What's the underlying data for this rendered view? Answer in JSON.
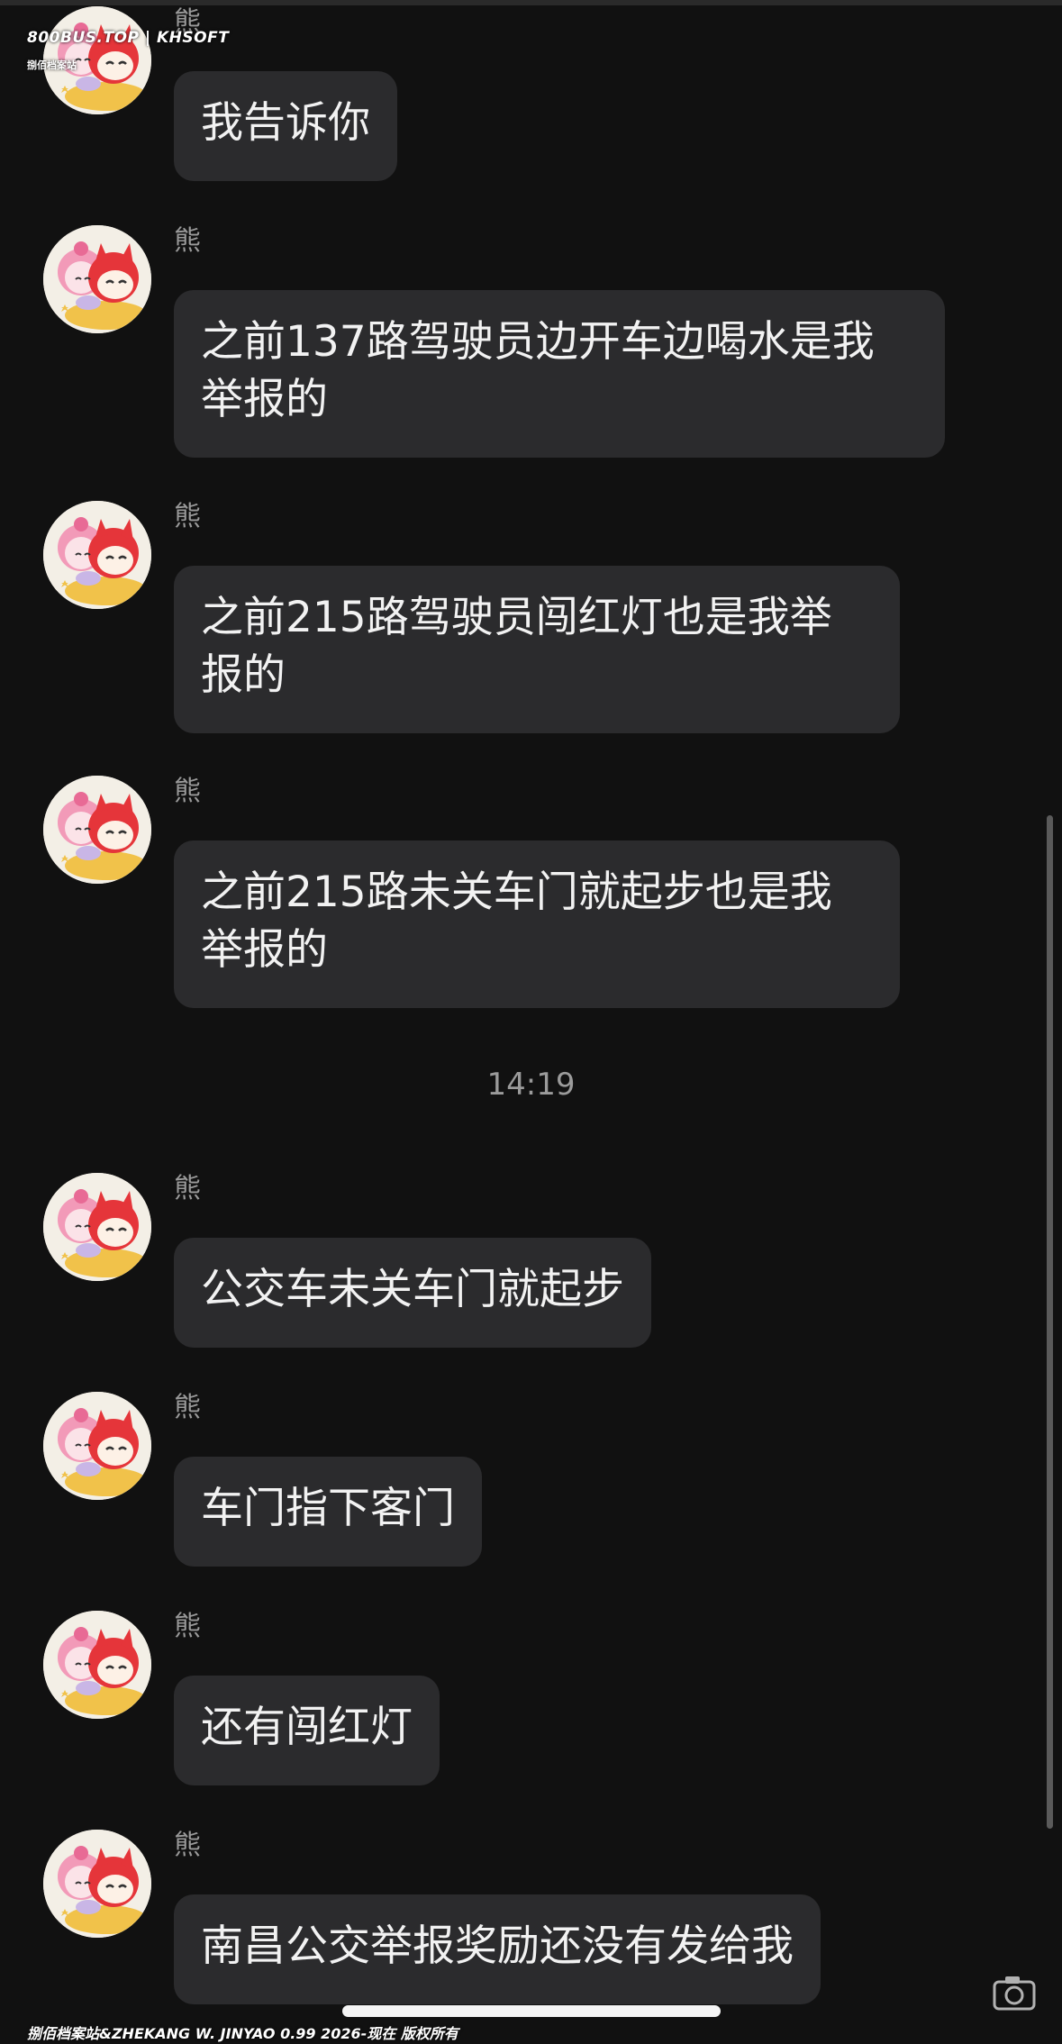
{
  "watermark": {
    "top": "800BUS.TOP | KHSOFT",
    "top_sub": "捌佰档案站",
    "bottom": "捌佰档案站&ZHEKANG W.  JINYAO 0.99 2026-现在 版权所有"
  },
  "timestamp": "14:19",
  "messages": [
    {
      "sender": "熊",
      "text": [
        "我告诉你"
      ]
    },
    {
      "sender": "熊",
      "text": [
        "之前137路驾驶员边开车边喝水是我",
        "举报的"
      ]
    },
    {
      "sender": "熊",
      "text": [
        "之前215路驾驶员闯红灯也是我举",
        "报的"
      ]
    },
    {
      "sender": "熊",
      "text": [
        "之前215路未关车门就起步也是我",
        "举报的"
      ]
    },
    {
      "sender": "熊",
      "text": [
        "公交车未关车门就起步"
      ]
    },
    {
      "sender": "熊",
      "text": [
        "车门指下客门"
      ]
    },
    {
      "sender": "熊",
      "text": [
        "还有闯红灯"
      ]
    },
    {
      "sender": "熊",
      "text": [
        "南昌公交举报奖励还没有发给我"
      ]
    }
  ]
}
